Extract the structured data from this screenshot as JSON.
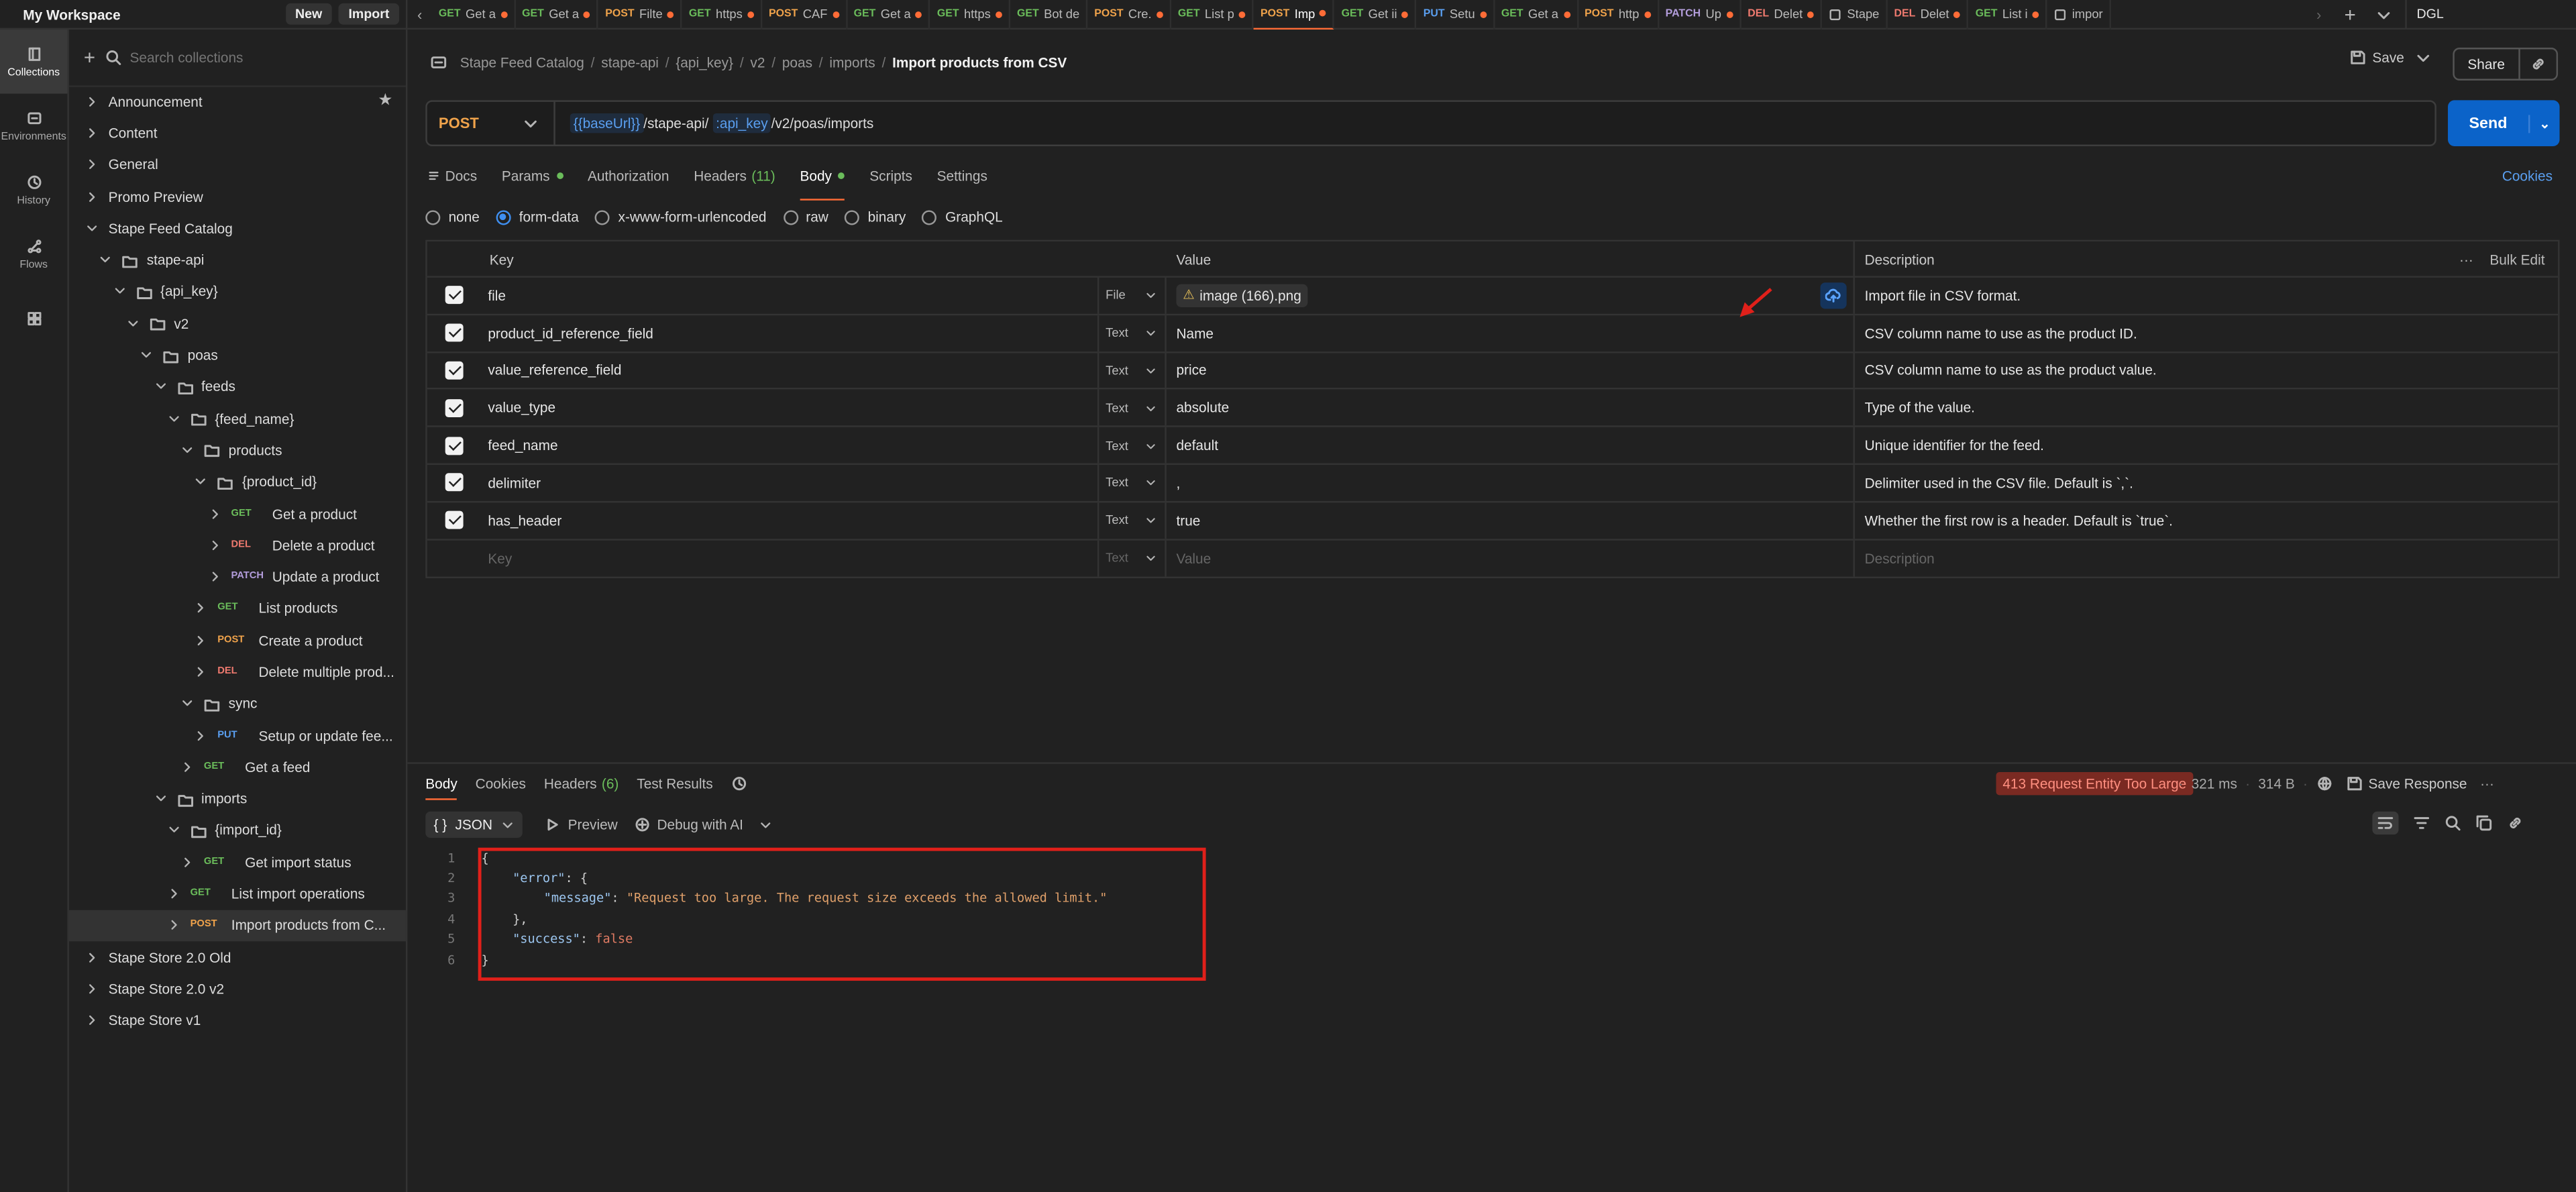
{
  "workspace": {
    "name": "My Workspace",
    "new_label": "New",
    "import_label": "Import"
  },
  "tabs": [
    {
      "method": "GET",
      "title": "Get a",
      "dot": true
    },
    {
      "method": "GET",
      "title": "Get a",
      "dot": true
    },
    {
      "method": "POST",
      "title": "Filte",
      "dot": true
    },
    {
      "method": "GET",
      "title": "https",
      "dot": true
    },
    {
      "method": "POST",
      "title": "CAF",
      "dot": true
    },
    {
      "method": "GET",
      "title": "Get a",
      "dot": true
    },
    {
      "method": "GET",
      "title": "https",
      "dot": true
    },
    {
      "method": "GET",
      "title": "Bot de",
      "dot": false
    },
    {
      "method": "POST",
      "title": "Cre.",
      "dot": true
    },
    {
      "method": "GET",
      "title": "List p",
      "dot": true
    },
    {
      "method": "POST",
      "title": "Imp",
      "dot": true,
      "active": true
    },
    {
      "method": "GET",
      "title": "Get ii",
      "dot": true
    },
    {
      "method": "PUT",
      "title": "Setu",
      "dot": true
    },
    {
      "method": "GET",
      "title": "Get a",
      "dot": true
    },
    {
      "method": "POST",
      "title": "http",
      "dot": true
    },
    {
      "method": "PATCH",
      "title": "Up",
      "dot": true
    },
    {
      "method": "DEL",
      "title": "Delet",
      "dot": true
    },
    {
      "method": "",
      "title": "Stape",
      "dot": false
    },
    {
      "method": "DEL",
      "title": "Delet",
      "dot": true
    },
    {
      "method": "GET",
      "title": "List i",
      "dot": true
    },
    {
      "method": "",
      "title": "impor",
      "dot": false
    }
  ],
  "environment": {
    "name": "DGL"
  },
  "rail": [
    {
      "label": "Collections",
      "icon": "collections-icon",
      "active": true
    },
    {
      "label": "Environments",
      "icon": "environments-icon"
    },
    {
      "label": "History",
      "icon": "history-icon"
    },
    {
      "label": "Flows",
      "icon": "flows-icon"
    },
    {
      "label": "",
      "icon": "apps-icon"
    }
  ],
  "sidebar": {
    "search_placeholder": "Search collections",
    "tree": [
      {
        "label": "Announcement",
        "depth": 0,
        "type": "collection",
        "open": false,
        "star": true
      },
      {
        "label": "Content",
        "depth": 0,
        "type": "collection",
        "open": false
      },
      {
        "label": "General",
        "depth": 0,
        "type": "collection",
        "open": false
      },
      {
        "label": "Promo Preview",
        "depth": 0,
        "type": "collection",
        "open": false
      },
      {
        "label": "Stape Feed Catalog",
        "depth": 0,
        "type": "collection",
        "open": true
      },
      {
        "label": "stape-api",
        "depth": 1,
        "type": "folder",
        "open": true
      },
      {
        "label": "{api_key}",
        "depth": 2,
        "type": "folder",
        "open": true
      },
      {
        "label": "v2",
        "depth": 3,
        "type": "folder",
        "open": true
      },
      {
        "label": "poas",
        "depth": 4,
        "type": "folder",
        "open": true
      },
      {
        "label": "feeds",
        "depth": 5,
        "type": "folder",
        "open": true
      },
      {
        "label": "{feed_name}",
        "depth": 6,
        "type": "folder",
        "open": true
      },
      {
        "label": "products",
        "depth": 7,
        "type": "folder",
        "open": true
      },
      {
        "label": "{product_id}",
        "depth": 8,
        "type": "folder",
        "open": true
      },
      {
        "label": "Get a product",
        "depth": 9,
        "type": "request",
        "method": "GET"
      },
      {
        "label": "Delete a product",
        "depth": 9,
        "type": "request",
        "method": "DEL"
      },
      {
        "label": "Update a product",
        "depth": 9,
        "type": "request",
        "method": "PATCH"
      },
      {
        "label": "List products",
        "depth": 8,
        "type": "request",
        "method": "GET"
      },
      {
        "label": "Create a product",
        "depth": 8,
        "type": "request",
        "method": "POST"
      },
      {
        "label": "Delete multiple prod...",
        "depth": 8,
        "type": "request",
        "method": "DEL"
      },
      {
        "label": "sync",
        "depth": 7,
        "type": "folder",
        "open": true
      },
      {
        "label": "Setup or update fee...",
        "depth": 8,
        "type": "request",
        "method": "PUT"
      },
      {
        "label": "Get a feed",
        "depth": 7,
        "type": "request",
        "method": "GET"
      },
      {
        "label": "imports",
        "depth": 5,
        "type": "folder",
        "open": true
      },
      {
        "label": "{import_id}",
        "depth": 6,
        "type": "folder",
        "open": true
      },
      {
        "label": "Get import status",
        "depth": 7,
        "type": "request",
        "method": "GET"
      },
      {
        "label": "List import operations",
        "depth": 6,
        "type": "request",
        "method": "GET"
      },
      {
        "label": "Import products from C...",
        "depth": 6,
        "type": "request",
        "method": "POST",
        "selected": true
      },
      {
        "label": "Stape Store 2.0 Old",
        "depth": 0,
        "type": "collection",
        "open": false
      },
      {
        "label": "Stape Store 2.0 v2",
        "depth": 0,
        "type": "collection",
        "open": false
      },
      {
        "label": "Stape Store v1",
        "depth": 0,
        "type": "collection",
        "open": false
      }
    ]
  },
  "request": {
    "breadcrumb": [
      "Stape Feed Catalog",
      "stape-api",
      "{api_key}",
      "v2",
      "poas",
      "imports"
    ],
    "title": "Import products from CSV",
    "save_label": "Save",
    "share_label": "Share",
    "method": "POST",
    "url_var1": "{{baseUrl}}",
    "url_part1": "/stape-api/",
    "url_var2": ":api_key",
    "url_part2": "/v2/poas/imports",
    "send_label": "Send",
    "tabs": [
      {
        "label": "Docs"
      },
      {
        "label": "Params",
        "dot": true
      },
      {
        "label": "Authorization"
      },
      {
        "label": "Headers",
        "count": "(11)"
      },
      {
        "label": "Body",
        "dot": true,
        "active": true
      },
      {
        "label": "Scripts"
      },
      {
        "label": "Settings"
      }
    ],
    "cookies_label": "Cookies",
    "body_types": [
      {
        "label": "none"
      },
      {
        "label": "form-data",
        "checked": true
      },
      {
        "label": "x-www-form-urlencoded"
      },
      {
        "label": "raw"
      },
      {
        "label": "binary"
      },
      {
        "label": "GraphQL"
      }
    ],
    "table_headers": {
      "key": "Key",
      "value": "Value",
      "description": "Description",
      "bulk_edit": "Bulk Edit"
    },
    "rows": [
      {
        "key": "file",
        "type": "File",
        "value": "image (166).png",
        "description": "Import file in CSV format."
      },
      {
        "key": "product_id_reference_field",
        "type": "Text",
        "value": "Name",
        "description": "CSV column name to use as the product ID."
      },
      {
        "key": "value_reference_field",
        "type": "Text",
        "value": "price",
        "description": "CSV column name to use as the product value."
      },
      {
        "key": "value_type",
        "type": "Text",
        "value": "absolute",
        "description": "Type of the value."
      },
      {
        "key": "feed_name",
        "type": "Text",
        "value": "default",
        "description": "Unique identifier for the feed."
      },
      {
        "key": "delimiter",
        "type": "Text",
        "value": ",",
        "description": "Delimiter used in the CSV file. Default is `,`."
      },
      {
        "key": "has_header",
        "type": "Text",
        "value": "true",
        "description": "Whether the first row is a header. Default is `true`."
      }
    ],
    "empty_row": {
      "key": "Key",
      "type": "Text",
      "value": "Value",
      "description": "Description"
    }
  },
  "response": {
    "tabs": [
      {
        "label": "Body",
        "active": true
      },
      {
        "label": "Cookies"
      },
      {
        "label": "Headers",
        "count": "(6)"
      },
      {
        "label": "Test Results"
      }
    ],
    "status": "413 Request Entity Too Large",
    "time": "321 ms",
    "size": "314 B",
    "save_response_label": "Save Response",
    "format": "JSON",
    "format_icon": "{ }",
    "preview_label": "Preview",
    "debug_label": "Debug with AI",
    "code_lines": [
      {
        "n": "1",
        "indent": 0,
        "parts": [
          [
            "p",
            "{"
          ]
        ]
      },
      {
        "n": "2",
        "indent": 1,
        "parts": [
          [
            "k",
            "\"error\""
          ],
          [
            "p",
            ": {"
          ]
        ]
      },
      {
        "n": "3",
        "indent": 2,
        "parts": [
          [
            "k",
            "\"message\""
          ],
          [
            "p",
            ": "
          ],
          [
            "s",
            "\"Request too large. The request size exceeds the allowed limit.\""
          ]
        ]
      },
      {
        "n": "4",
        "indent": 1,
        "parts": [
          [
            "p",
            "},"
          ]
        ]
      },
      {
        "n": "5",
        "indent": 1,
        "parts": [
          [
            "k",
            "\"success\""
          ],
          [
            "p",
            ": "
          ],
          [
            "b",
            "false"
          ]
        ]
      },
      {
        "n": "6",
        "indent": 0,
        "parts": [
          [
            "p",
            "}"
          ]
        ]
      }
    ]
  }
}
